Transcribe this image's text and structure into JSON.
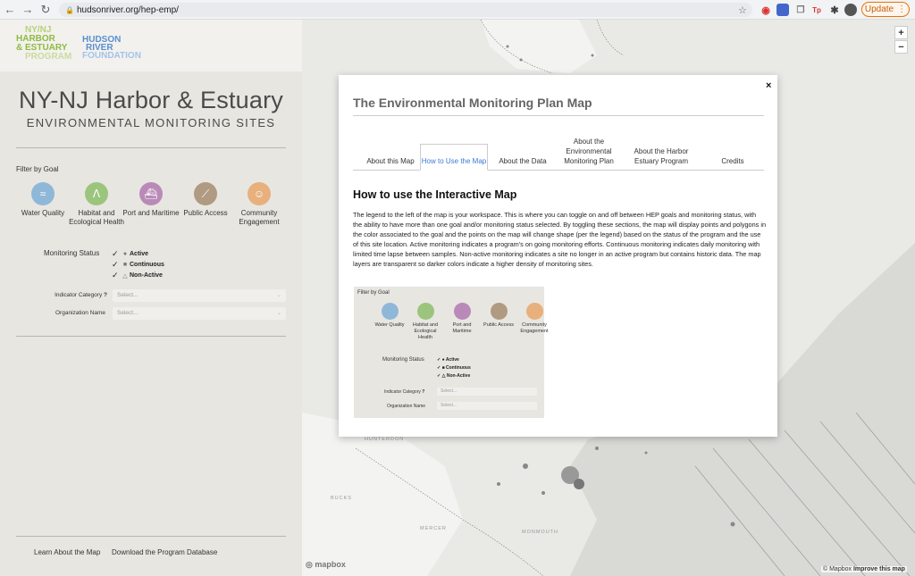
{
  "browser": {
    "url": "hudsonriver.org/hep-emp/",
    "update_label": "Update",
    "ext_tp": "Tp"
  },
  "logos": {
    "nynj": [
      "NY/NJ",
      "HARBOR",
      "& ESTUARY",
      "PROGRAM"
    ],
    "hrf": [
      "HUDSON",
      "RIVER",
      "FOUNDATION"
    ]
  },
  "sidebar": {
    "title": "NY-NJ Harbor & Estuary",
    "subtitle": "ENVIRONMENTAL MONITORING SITES",
    "filter_label": "Filter by Goal",
    "goals": [
      {
        "label": "Water Quality",
        "color": "#8fb8d8",
        "icon": "wave-icon"
      },
      {
        "label": "Habitat and Ecological Health",
        "color": "#9bc57c",
        "icon": "grass-icon"
      },
      {
        "label": "Port and Maritime",
        "color": "#b98ab8",
        "icon": "ship-icon"
      },
      {
        "label": "Public Access",
        "color": "#b09a82",
        "icon": "canoe-icon"
      },
      {
        "label": "Community Engagement",
        "color": "#e7b07c",
        "icon": "people-icon"
      }
    ],
    "status_label": "Monitoring Status",
    "statuses": [
      {
        "label": "Active",
        "marker": "●"
      },
      {
        "label": "Continuous",
        "marker": "■"
      },
      {
        "label": "Non-Active",
        "marker": "△"
      }
    ],
    "indicator_label": "Indicator Category",
    "indicator_help": "?",
    "indicator_placeholder": "Select...",
    "organization_label": "Organization Name",
    "organization_placeholder": "Select...",
    "learn_link": "Learn About the Map",
    "download_link": "Download the Program Database"
  },
  "map": {
    "zoom_in": "+",
    "zoom_out": "−",
    "mapbox_logo": "mapbox",
    "attribution_prefix": "© Mapbox",
    "attribution_link": "Improve this map",
    "labels": [
      "HUNTERDON",
      "BUCKS",
      "MERCER",
      "MONMOUTH"
    ]
  },
  "modal": {
    "title": "The Environmental Monitoring Plan Map",
    "close": "×",
    "tabs": [
      {
        "label": "About this Map",
        "active": false
      },
      {
        "label": "How to Use the Map",
        "active": true
      },
      {
        "label": "About the Data",
        "active": false
      },
      {
        "label": "About the Environmental Monitoring Plan",
        "active": false
      },
      {
        "label": "About the Harbor Estuary Program",
        "active": false
      },
      {
        "label": "Credits",
        "active": false
      }
    ],
    "heading": "How to use the Interactive Map",
    "body": "The legend to the left of the map is your workspace. This is where you can toggle on and off between HEP goals and monitoring status, with the ability to have more than one goal and/or monitoring status selected. By toggling these sections, the map will display points and polygons in the color associated to the goal and the points on the map will change shape (per the legend) based on the status of the program and the use of this site location. Active monitoring indicates a program's on going monitoring efforts. Continuous monitoring indicates daily monitoring with limited time lapse between samples. Non-active monitoring indicates a site no longer in an active program but contains historic data. The map layers are transparent so darker colors indicate a higher density of monitoring sites."
  }
}
